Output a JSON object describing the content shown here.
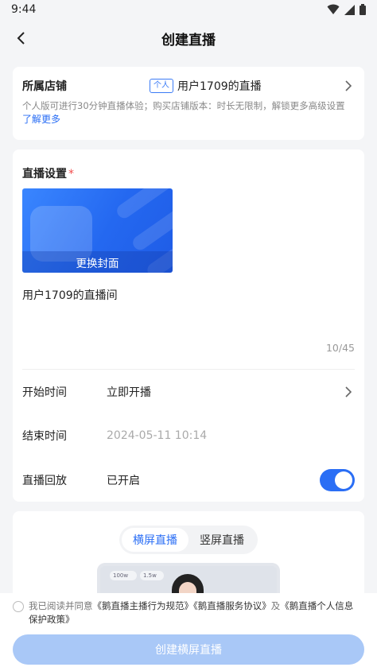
{
  "status": {
    "time": "9:44",
    "icons": [
      "wifi-icon",
      "signal-icon",
      "battery-icon"
    ]
  },
  "nav": {
    "title": "创建直播",
    "back_icon": "back-arrow-icon"
  },
  "store": {
    "label": "所属店铺",
    "tag": "个人",
    "name": "用户1709的直播",
    "desc": "个人版可进行30分钟直播体验；购买店铺版本：时长无限制，解锁更多高级设置",
    "link": "了解更多"
  },
  "settings": {
    "title": "直播设置",
    "required_mark": "*",
    "cover_button": "更换封面",
    "room_title": "用户1709的直播间",
    "title_count": "10/45",
    "start_label": "开始时间",
    "start_value": "立即开播",
    "end_label": "结束时间",
    "end_value": "2024-05-11 10:14",
    "replay_label": "直播回放",
    "replay_value": "已开启",
    "replay_on": true
  },
  "mode": {
    "tabs": [
      "横屏直播",
      "竖屏直播"
    ],
    "active_tab": "横屏直播",
    "preview_stats": [
      "100w",
      "1.5w"
    ]
  },
  "footer": {
    "agree_prefix": "我已阅读并同意",
    "link1": "《鹅直播主播行为规范》",
    "link2": "《鹅直播服务协议》",
    "and": "及",
    "link3": "《鹅直播个人信息保护政策》",
    "create_button": "创建横屏直播"
  },
  "colors": {
    "accent": "#2a6ef5",
    "required": "#f24c4c",
    "button_disabled": "#a9c8f7"
  }
}
